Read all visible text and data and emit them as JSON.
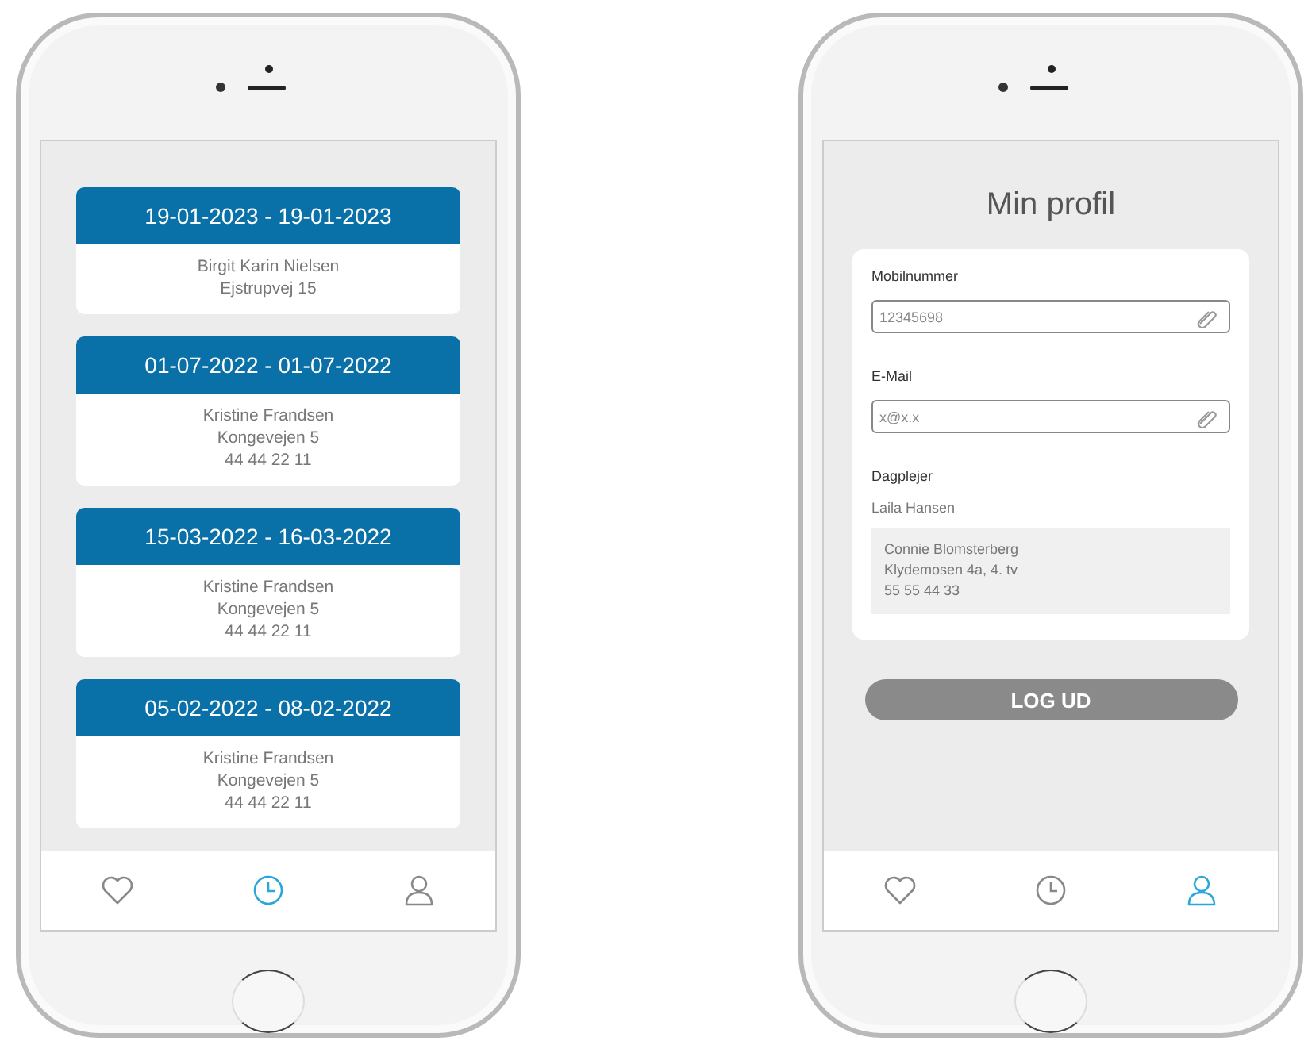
{
  "phones": [
    {
      "kind": "history",
      "entries": [
        {
          "dates": "19-01-2023 - 19-01-2023",
          "lines": [
            "Birgit Karin Nielsen",
            "Ejstrupvej 15"
          ]
        },
        {
          "dates": "01-07-2022 - 01-07-2022",
          "lines": [
            "Kristine Frandsen",
            "Kongevejen 5",
            "44 44 22 11"
          ]
        },
        {
          "dates": "15-03-2022 - 16-03-2022",
          "lines": [
            "Kristine Frandsen",
            "Kongevejen 5",
            "44 44 22 11"
          ]
        },
        {
          "dates": "05-02-2022 - 08-02-2022",
          "lines": [
            "Kristine Frandsen",
            "Kongevejen 5",
            "44 44 22 11"
          ]
        }
      ],
      "nav": [
        {
          "kind": "heart",
          "selected": false
        },
        {
          "kind": "clock",
          "selected": true
        },
        {
          "kind": "person",
          "selected": false
        }
      ]
    },
    {
      "kind": "profile",
      "title": "Min profil",
      "fields": [
        {
          "label": "Mobilnummer",
          "value": "12345698"
        },
        {
          "label": "E-Mail",
          "value": "x@x.x"
        }
      ],
      "caregiver": {
        "label": "Dagplejer",
        "name": "Laila Hansen",
        "substitute": [
          "Connie Blomsterberg",
          "Klydemosen 4a, 4. tv",
          "55 55 44 33"
        ]
      },
      "logout": "LOG UD",
      "nav": [
        {
          "kind": "heart",
          "selected": false
        },
        {
          "kind": "clock",
          "selected": false
        },
        {
          "kind": "person",
          "selected": true
        }
      ]
    }
  ]
}
